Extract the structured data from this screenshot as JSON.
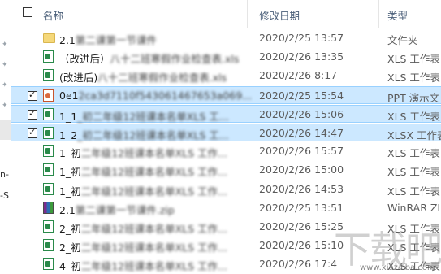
{
  "header": {
    "col_name": "名称",
    "col_date": "修改日期",
    "col_type": "类型"
  },
  "nav": {
    "frag1": "n-",
    "frag2": "-S"
  },
  "rows": [
    {
      "prefix": "2.1",
      "blur": "第二课第一节课件",
      "date": "2020/2/25 13:57",
      "type": "文件夹",
      "icon": "folder-icon",
      "checked": false,
      "selected": false
    },
    {
      "prefix": "（改进后）",
      "blur": "八十二班寒假作业检查表.xls",
      "date": "2020/2/26 13:35",
      "type": "XLS 工作表",
      "icon": "xls-file-icon",
      "checked": false,
      "selected": false
    },
    {
      "prefix": "(改进后)",
      "blur": "八十二班寒假作业检查表.xls",
      "date": "2020/2/26 8:17",
      "type": "XLS 工作表",
      "icon": "xls-file-icon",
      "checked": false,
      "selected": false
    },
    {
      "prefix": "0e1",
      "blur": "2ca3d7110f543061467653a069...",
      "date": "2020/2/25 15:54",
      "type": "PPT 演示文",
      "icon": "ppt-file-icon",
      "checked": true,
      "selected": true
    },
    {
      "prefix": "1_1",
      "blur": "_初二年级12班课本名单XLS 工...",
      "date": "2020/2/26 15:06",
      "type": "XLS 工作表",
      "icon": "xls-file-icon",
      "checked": true,
      "selected": true
    },
    {
      "prefix": "1_2",
      "blur": "_初二年级12班课本名单XLS 工...",
      "date": "2020/2/26 14:47",
      "type": "XLSX 工作表",
      "icon": "xls-file-icon",
      "checked": true,
      "selected": true
    },
    {
      "prefix": "1_初",
      "blur": "二年级12班课本名单XLS 工作...",
      "date": "2020/2/26 15:57",
      "type": "XLS 工作表",
      "icon": "xls-file-icon",
      "checked": false,
      "selected": false
    },
    {
      "prefix": "1_初",
      "blur": "二年级12班课本名单XLS 工作...",
      "date": "2020/2/26 15:00",
      "type": "XLS 工作表",
      "icon": "xls-file-icon",
      "checked": false,
      "selected": false
    },
    {
      "prefix": "1_初",
      "blur": "二年级12班课本名单XLS 工作...",
      "date": "2020/2/26 14:53",
      "type": "XLS 工作表",
      "icon": "xls-file-icon",
      "checked": false,
      "selected": false
    },
    {
      "prefix": "2.1",
      "blur": "第二课第一节课件.zip",
      "date": "2020/2/25 13:51",
      "type": "WinRAR ZI",
      "icon": "winrar-archive-icon",
      "checked": false,
      "selected": false
    },
    {
      "prefix": "2_初",
      "blur": "二年级12班课本名单XLS 工作...",
      "date": "2020/2/26 15:25",
      "type": "XLS 工作表",
      "icon": "xls-file-icon",
      "checked": false,
      "selected": false
    },
    {
      "prefix": "2_初",
      "blur": "二年级12班课本名单XLS 工作...",
      "date": "2020/2/26 15:10",
      "type": "XLS 工作表",
      "icon": "xls-file-icon",
      "checked": false,
      "selected": false
    },
    {
      "prefix": "4_初",
      "blur": "二年级12班课本名单XLS 工作...",
      "date": "2020/2/26 17:4",
      "type": "XLS 工作表",
      "icon": "xls-file-icon",
      "checked": false,
      "selected": false
    }
  ],
  "watermark": {
    "text": "下载吧",
    "url": "www.xiazaiba.com"
  },
  "colors": {
    "selection": "#cce8ff",
    "selection_border": "#99d1ff",
    "header_text": "#4c607a"
  }
}
